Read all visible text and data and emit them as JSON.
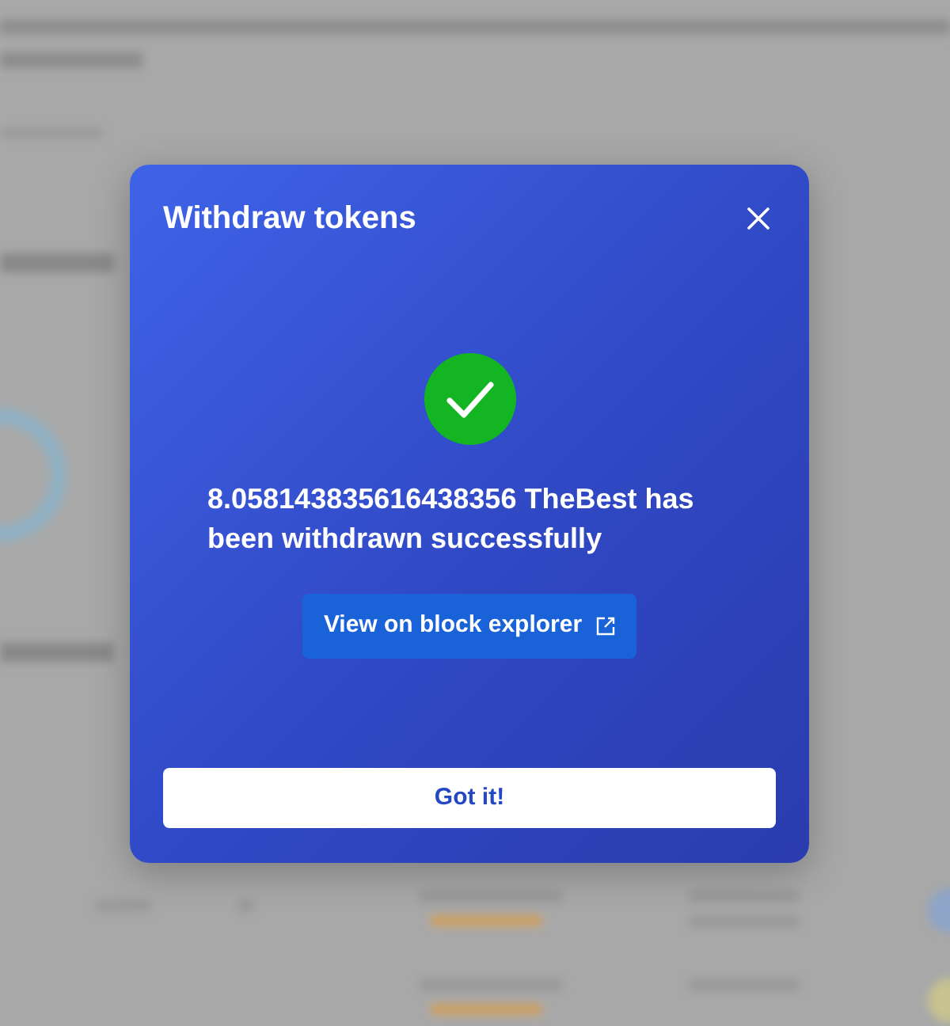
{
  "dialog": {
    "title": "Withdraw tokens",
    "message": "8.058143835616438356 TheBest has been withdrawn successfully",
    "explorer_link": {
      "label": "View on block explorer"
    },
    "confirm_button": {
      "label": "Got it!"
    }
  }
}
